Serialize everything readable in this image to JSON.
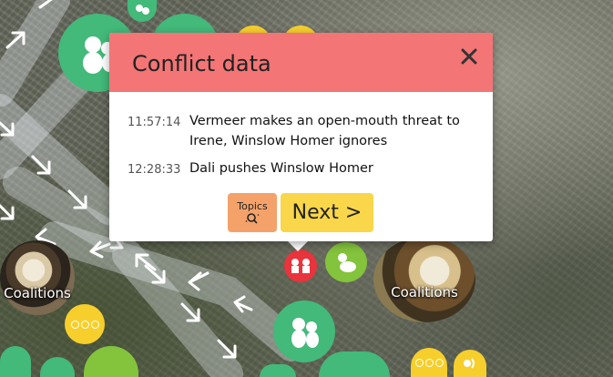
{
  "modal": {
    "title": "Conflict data",
    "close_icon": "close-icon",
    "events": [
      {
        "time": "11:57:14",
        "text": "Vermeer makes an open-mouth threat to Irene, Winslow Homer ignores"
      },
      {
        "time": "12:28:33",
        "text": "Dali pushes Winslow Homer"
      }
    ],
    "topics_button": {
      "label": "Topics",
      "icon": "search-icon"
    },
    "next_button": {
      "label": "Next >"
    }
  },
  "nodes": {
    "coalitions_left_label": "Coalitions",
    "coalitions_right_label": "Coalitions",
    "node_icons": [
      "monkey-icon",
      "conflict-icon",
      "dots-icon",
      "sound-icon",
      "grooming-icon"
    ]
  },
  "colors": {
    "header": "#f37575",
    "next_button": "#f9d64a",
    "topics_button": "#f4a26a",
    "green_node": "#43b97a",
    "lime_node": "#84c33c",
    "red_node": "#e8343c",
    "yellow_node": "#f6cf2c"
  }
}
